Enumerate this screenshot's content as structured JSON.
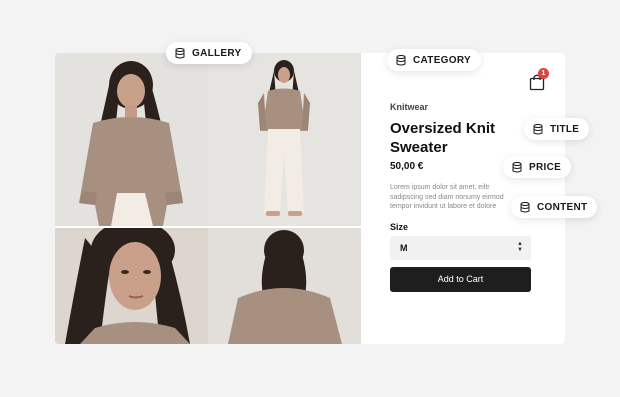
{
  "annotations": {
    "gallery": "GALLERY",
    "category": "CATEGORY",
    "title": "TITLE",
    "price": "PRICE",
    "content": "CONTENT"
  },
  "product": {
    "category": "Knitwear",
    "title": "Oversized Knit Sweater",
    "price": "50,00 €",
    "description": "Lorem ipsum dolor sit amet, eiltr sadipscing sed diam nonumy eirmod tempor invidunt ut labore et dolore",
    "size_label": "Size",
    "size_value": "M",
    "add_to_cart": "Add to Cart",
    "cart_count": "1"
  },
  "icons": {
    "cart": "shopping-bag-icon",
    "annotation": "database-icon",
    "select": "up-down-chevron-icon"
  },
  "colors": {
    "background": "#f3f3f3",
    "button": "#1e1e1e",
    "badge": "#e0443e",
    "sweater": "#a89080"
  }
}
